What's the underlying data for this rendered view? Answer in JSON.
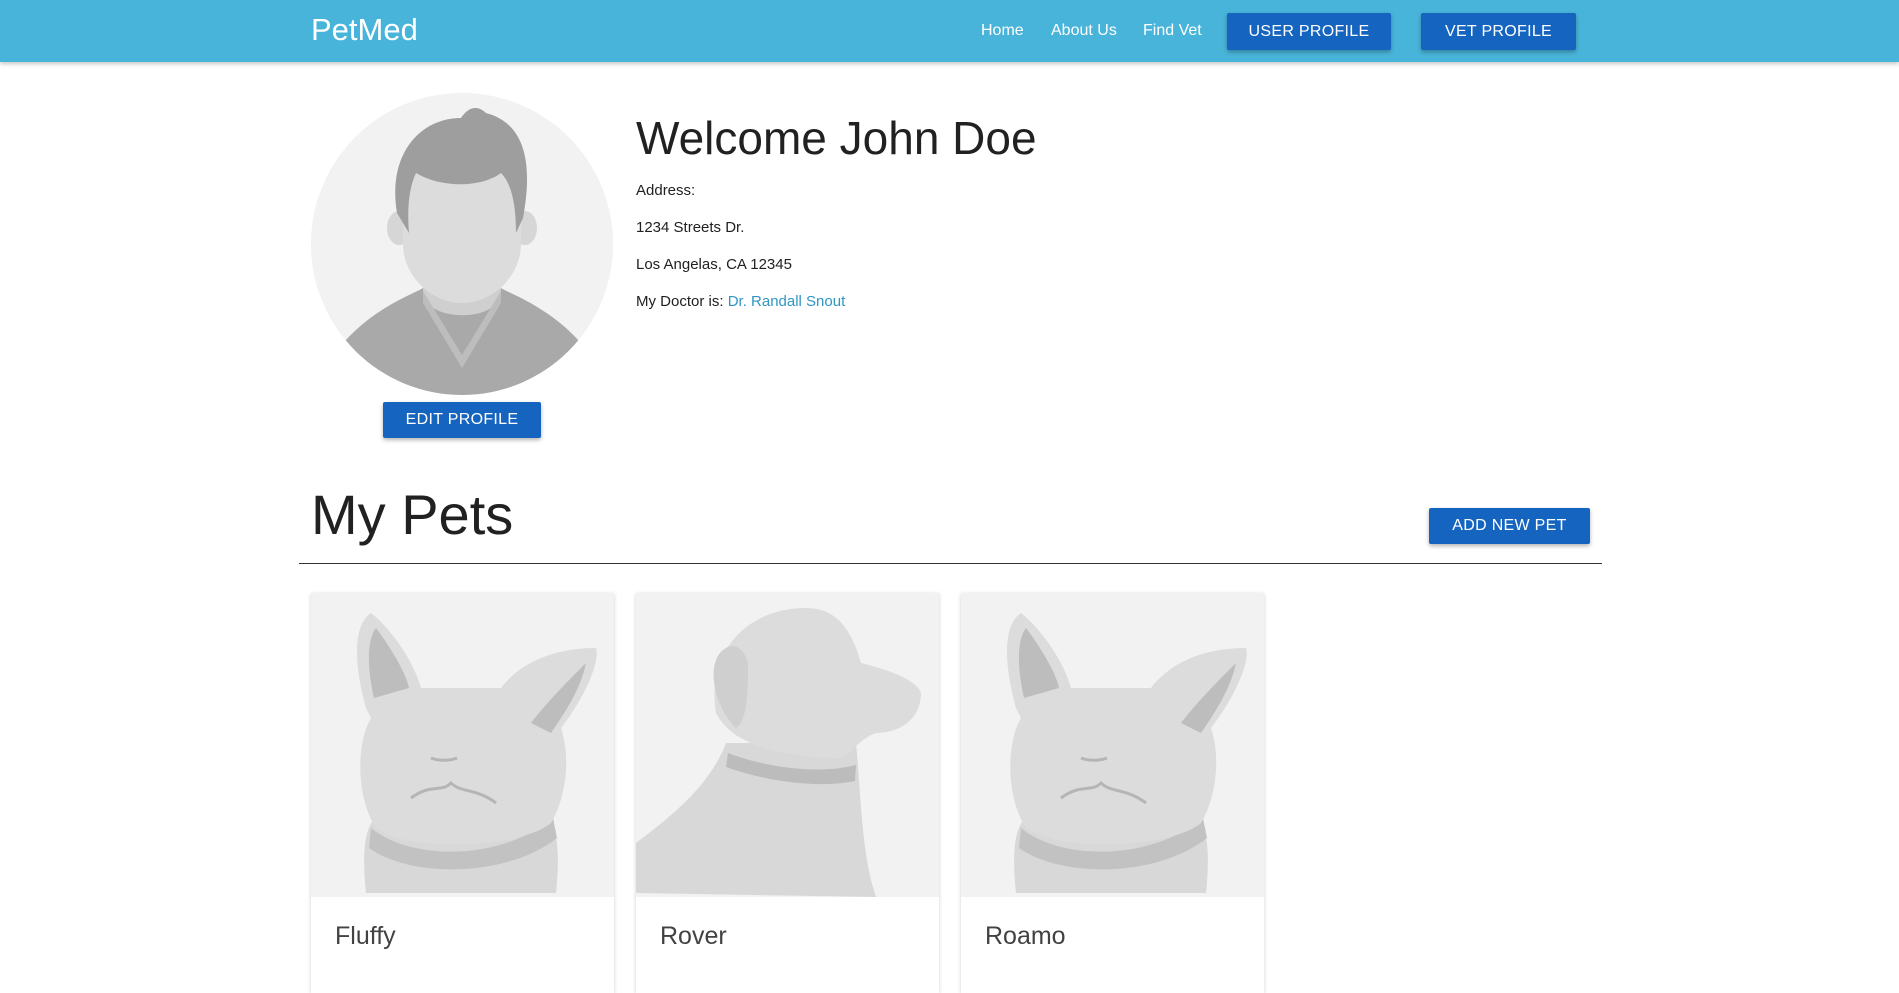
{
  "navbar": {
    "brand": "PetMed",
    "links": [
      "Home",
      "About Us",
      "Find Vet"
    ],
    "user_profile_button": "USER PROFILE",
    "vet_profile_button": "VET PROFILE",
    "background_color": "#48b4d9",
    "button_color": "#1565c0"
  },
  "profile": {
    "welcome": "Welcome John Doe",
    "address_label": "Address:",
    "address_line1": "1234 Streets Dr.",
    "address_line2": "Los Angelas, CA 12345",
    "doctor_label": "My Doctor is:",
    "doctor_name": "Dr. Randall Snout",
    "edit_button": "EDIT PROFILE",
    "avatar_icon": "user-avatar-placeholder"
  },
  "pets": {
    "title": "My Pets",
    "add_button": "ADD NEW PET",
    "items": [
      {
        "name": "Fluffy",
        "image": "cat-placeholder"
      },
      {
        "name": "Rover",
        "image": "dog-placeholder"
      },
      {
        "name": "Roamo",
        "image": "cat-placeholder"
      }
    ]
  }
}
